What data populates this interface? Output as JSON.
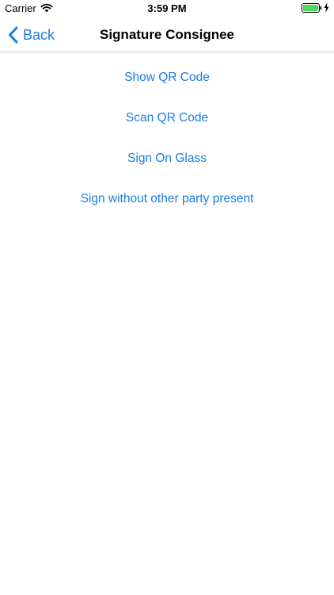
{
  "status_bar": {
    "carrier": "Carrier",
    "time": "3:59 PM",
    "battery_color": "#4cd964"
  },
  "nav": {
    "back_label": "Back",
    "title": "Signature Consignee",
    "accent_color": "#1a7ee3"
  },
  "options": [
    {
      "label": "Show QR Code"
    },
    {
      "label": "Scan QR Code"
    },
    {
      "label": "Sign On Glass"
    },
    {
      "label": "Sign without other party present"
    }
  ]
}
